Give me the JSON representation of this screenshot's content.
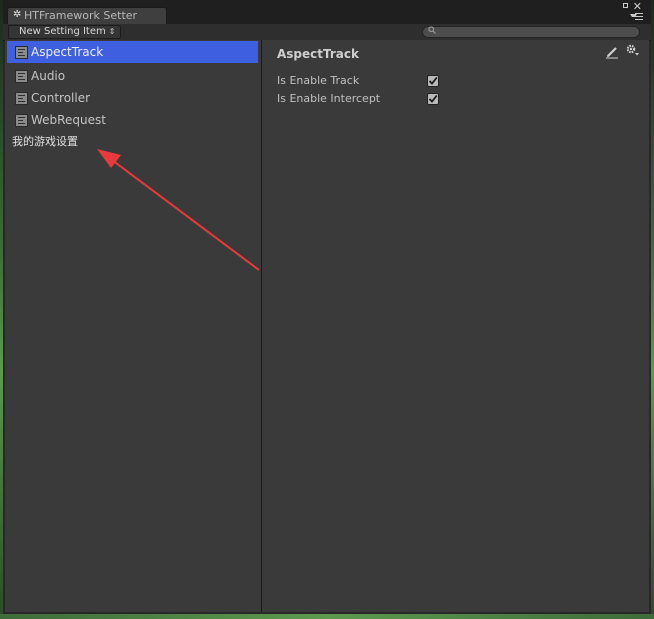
{
  "window": {
    "tab_title": "HTFramework Setter",
    "tab_icon": "gear-icon"
  },
  "toolbar": {
    "dropdown_label": "New Setting Item",
    "dropdown_arrow": "⇕",
    "search_value": ""
  },
  "sidebar": {
    "items": [
      {
        "label": "AspectTrack",
        "icon": "setting-item-icon",
        "selected": true
      },
      {
        "label": "Audio",
        "icon": "setting-item-icon",
        "selected": false
      },
      {
        "label": "Controller",
        "icon": "setting-item-icon",
        "selected": false
      },
      {
        "label": "WebRequest",
        "icon": "setting-item-icon",
        "selected": false
      }
    ],
    "annotation_text": "我的游戏设置"
  },
  "inspector": {
    "title": "AspectTrack",
    "fields": [
      {
        "label": "Is Enable Track",
        "checked": true
      },
      {
        "label": "Is Enable Intercept",
        "checked": true
      }
    ]
  },
  "colors": {
    "selection": "#3e60e0",
    "panel_bg": "#3a3a3a",
    "annotation_arrow": "#e83a3a"
  }
}
